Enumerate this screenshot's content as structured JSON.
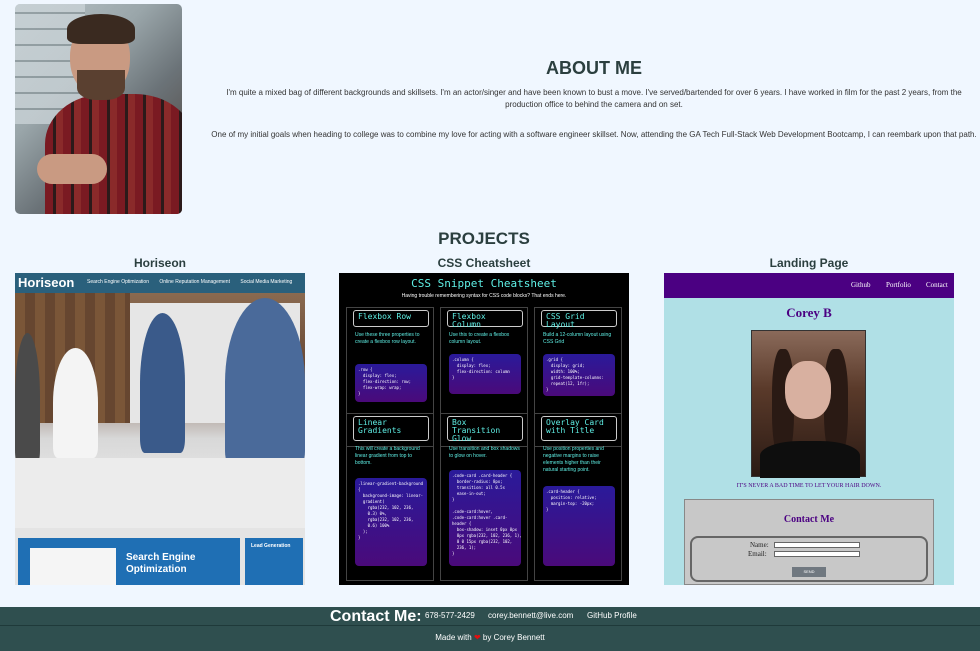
{
  "about": {
    "title": "ABOUT ME",
    "paragraph1": "I'm quite a mixed bag of different backgrounds and skillsets. I'm an actor/singer and have been known to bust a move. I've served/bartended for over 6 years. I have worked in film for the past 2 years, from the production office to behind the camera and on set.",
    "paragraph2": "One of my initial goals when heading to college was to combine my love for acting with a software engineer skillset. Now, attending the GA Tech Full-Stack Web Development Bootcamp, I can reembark upon that path."
  },
  "projects": {
    "title": "PROJECTS",
    "items": [
      {
        "title": "Horiseon"
      },
      {
        "title": "CSS Cheatsheet"
      },
      {
        "title": "Landing Page"
      }
    ]
  },
  "horiseon": {
    "logo": "Horiseon",
    "nav": [
      "Search Engine Optimization",
      "Online Reputation Management",
      "Social Media Marketing"
    ],
    "card_title": "Search Engine Optimization",
    "side_title": "Lead Generation"
  },
  "cheatsheet": {
    "title": "CSS Snippet Cheatsheet",
    "subtitle": "Having trouble remembering syntax for CSS code blocks? That ends here.",
    "cards": [
      {
        "title": "Flexbox Row",
        "desc": "Use these three properties to create a flexbox row layout.",
        "code": ".row {\n  display: flex;\n  flex-direction: row;\n  flex-wrap: wrap;\n}"
      },
      {
        "title": "Flexbox Column",
        "desc": "Use this to create a flexbox column layout.",
        "code": ".column {\n  display: flex;\n  flex-direction: column\n}"
      },
      {
        "title": "CSS Grid Layout",
        "desc": "Build a 12-column layout using CSS Grid",
        "code": ".grid {\n  display: grid;\n  width: 100%;\n  grid-template-columns:\n  repeat(12, 1fr);\n}"
      },
      {
        "title": "Linear Gradients",
        "desc": "This will create a background linear gradient from top to bottom.",
        "code": ".linear-gradient-background\n{\n  background-image: linear-\n  gradient(\n    rgba(232, 102, 236,\n    0.3) 0%,\n    rgba(232, 102, 236,\n    0.6) 100%\n  );\n}"
      },
      {
        "title": "Box Transition Glow",
        "desc": "Use transition and box shadows to glow on hover.",
        "code": ".code-card .card-header {\n  border-radius: 8px;\n  transition: all 0.5s\n  ease-in-out;\n}\n\n.code-card:hover,\n.code-card:hover .card-\nheader {\n  box-shadow: inset 0px 0px\n  8px rgba(232, 102, 236, 1),\n  0 0 15px rgba(232, 102,\n  236, 1);\n}"
      },
      {
        "title": "Overlay Card with Title",
        "desc": "Use position properties and negative margins to raise elements higher than their natural starting point.",
        "code": ".card-header {\n  position: relative;\n  margin-top: -20px;\n}"
      }
    ]
  },
  "landing": {
    "nav": [
      "Github",
      "Portfolio",
      "Contact"
    ],
    "name": "Corey B",
    "tagline": "IT'S NEVER A BAD TIME TO LET YOUR HAIR DOWN.",
    "contact_title": "Contact Me",
    "name_label": "Name:",
    "email_label": "Email:",
    "send_label": "SEND"
  },
  "footer": {
    "contact_title": "Contact Me:",
    "phone": "678-577-2429",
    "email": "corey.bennett@live.com",
    "github": "GitHub Profile",
    "made_with": "Made with",
    "heart": "❤",
    "by": "by Corey Bennett"
  },
  "colors": {
    "background": "#f0f7ff",
    "heading": "#2b3f3f",
    "footer": "#2f4f4f",
    "landing_purple": "#4b0082",
    "cheatsheet_accent": "#5ff0e6"
  }
}
